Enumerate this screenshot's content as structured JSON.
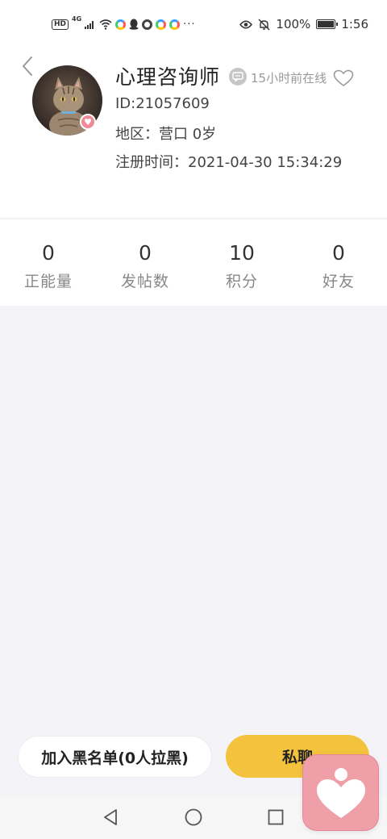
{
  "status_bar": {
    "hd": "HD",
    "network": "4G",
    "more": "···",
    "battery": "100%",
    "time": "1:56",
    "battery_level": 1.0
  },
  "profile": {
    "name": "心理咨询师",
    "online_status": "15小时前在线",
    "id_text": "ID:21057609",
    "area_text": "地区：营口 0岁",
    "register_text": "注册时间：2021-04-30 15:34:29"
  },
  "stats": [
    {
      "value": "0",
      "label": "正能量"
    },
    {
      "value": "0",
      "label": "发帖数"
    },
    {
      "value": "10",
      "label": "积分"
    },
    {
      "value": "0",
      "label": "好友"
    }
  ],
  "actions": {
    "blacklist_label": "加入黑名单(0人拉黑)",
    "chat_label": "私聊"
  },
  "colors": {
    "accent": "#f3c33e",
    "app_icon": "#ef9fa8",
    "page_bg": "#f3f3f8"
  },
  "icons": {
    "back": "chevron-left-icon",
    "chat": "message-bubble-icon",
    "follow": "heart-outline-icon",
    "nav_back": "triangle-back-icon",
    "nav_home": "circle-home-icon",
    "nav_recent": "square-recent-icon",
    "floating_app": "heart-person-icon"
  }
}
